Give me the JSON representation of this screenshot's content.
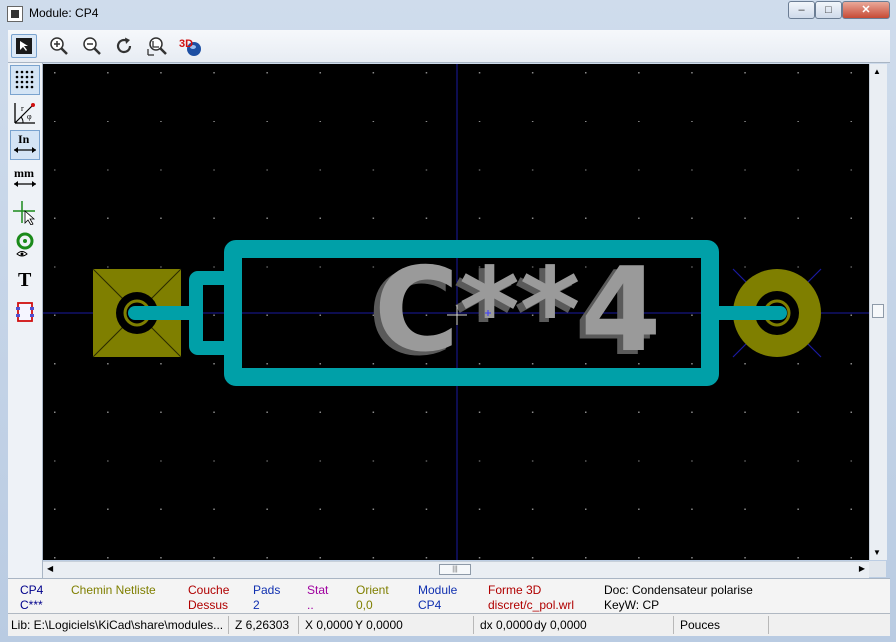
{
  "window": {
    "title": "Module: CP4"
  },
  "toolbar": {
    "buttons": [
      "select-tool-icon",
      "zoom-in-icon",
      "zoom-out-icon",
      "redraw-icon",
      "zoom-fit-icon",
      "view-3d-icon"
    ],
    "view3d_label": "3D"
  },
  "left_toolbar": {
    "buttons": [
      "grid-icon",
      "polar-coords-icon",
      "units-inch-icon",
      "units-mm-icon",
      "cursor-shape-icon",
      "pad-sketch-icon",
      "text-sketch-icon",
      "edge-sketch-icon"
    ],
    "inch_label": "In",
    "mm_label": "mm",
    "text_label": "T"
  },
  "canvas": {
    "reference_text": "C**4",
    "colors": {
      "background": "#000000",
      "silkscreen": "#00a0a8",
      "pad": "#7f7f00",
      "text": "#9a9a9a",
      "axis": "#1a1aa0"
    }
  },
  "message_panel": {
    "col1": {
      "top": "CP4",
      "bottom": "C***"
    },
    "col2": {
      "label": "Chemin Netliste",
      "value": ""
    },
    "col3": {
      "label": "Couche",
      "value": "Dessus"
    },
    "col4": {
      "label": "Pads",
      "value": "2"
    },
    "col5": {
      "label": "Stat",
      "value": ".."
    },
    "col6": {
      "label": "Orient",
      "value": "0,0"
    },
    "col7": {
      "label": "Module",
      "value": "CP4"
    },
    "col8": {
      "label": "Forme 3D",
      "value": "discret/c_pol.wrl"
    },
    "col9": {
      "top": "Doc: Condensateur polarise",
      "bottom": "KeyW: CP"
    }
  },
  "status_bar": {
    "lib": "Lib: E:\\Logiciels\\KiCad\\share\\modules...",
    "zoom": "Z 6,26303",
    "x": "X 0,0000",
    "y": "Y 0,0000",
    "dx": "dx 0,0000",
    "dy": "dy 0,0000",
    "units": "Pouces"
  }
}
